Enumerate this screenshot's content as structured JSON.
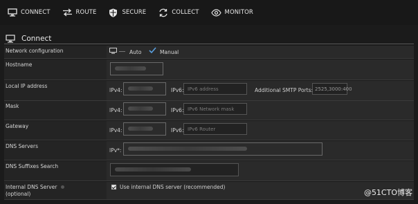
{
  "nav": {
    "items": [
      {
        "label": "CONNECT",
        "icon": "monitor-icon"
      },
      {
        "label": "ROUTE",
        "icon": "arrows-icon"
      },
      {
        "label": "SECURE",
        "icon": "shield-icon"
      },
      {
        "label": "COLLECT",
        "icon": "cycle-icon"
      },
      {
        "label": "MONITOR",
        "icon": "eye-icon"
      }
    ]
  },
  "section": {
    "title": "Connect",
    "icon": "monitor-icon"
  },
  "form": {
    "network_config": {
      "label": "Network configuration",
      "auto": "Auto",
      "manual": "Manual",
      "selected": "Manual"
    },
    "hostname": {
      "label": "Hostname"
    },
    "local_ip": {
      "label": "Local IP address",
      "ipv4_label": "IPv4:",
      "ipv6_label": "IPv6:",
      "ipv6_placeholder": "IPv6 address",
      "smtp_label": "Additional SMTP Ports:",
      "smtp_value": "2525,3000:400"
    },
    "mask": {
      "label": "Mask",
      "ipv4_label": "IPv4:",
      "ipv6_label": "IPv6:",
      "ipv6_placeholder": "IPv6 Network mask"
    },
    "gateway": {
      "label": "Gateway",
      "ipv4_label": "IPv4:",
      "ipv6_label": "IPv6:",
      "ipv6_placeholder": "IPv6 Router"
    },
    "dns": {
      "label": "DNS Servers",
      "ip_label": "IPv*:"
    },
    "dns_suffix": {
      "label": "DNS Suffixes Search"
    },
    "internal_dns": {
      "label": "Internal DNS Server",
      "label2": "(optional)",
      "checkbox_label": "Use internal DNS server (recommended)",
      "checked": true
    }
  },
  "watermark": "@51CTO博客"
}
